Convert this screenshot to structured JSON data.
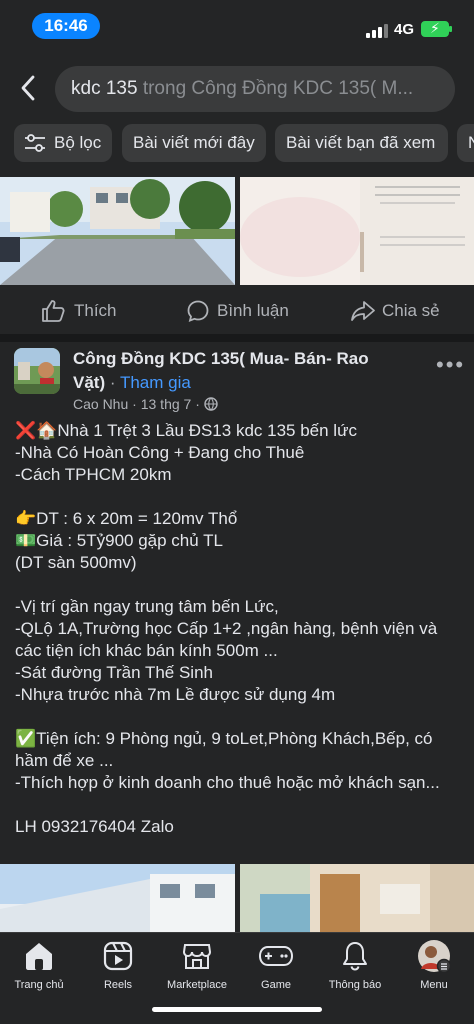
{
  "status": {
    "time": "16:46",
    "network": "4G"
  },
  "search": {
    "query": "kdc 135",
    "scope": " trong Công Đồng KDC 135( M..."
  },
  "chips": [
    {
      "label": "Bộ lọc"
    },
    {
      "label": "Bài viết mới đây"
    },
    {
      "label": "Bài viết bạn đã xem"
    },
    {
      "label": "N"
    }
  ],
  "actions": {
    "like": "Thích",
    "comment": "Bình luận",
    "share": "Chia sẻ"
  },
  "post": {
    "group_name": "Công Đồng KDC 135( Mua- Bán- Rao Vặt)",
    "separator": " · ",
    "join": "Tham gia",
    "author": "Cao Nhu",
    "date": "13 thg 7",
    "lines": [
      "❌🏠Nhà 1 Trệt 3 Lầu ĐS13 kdc 135 bến lức",
      "-Nhà Có Hoàn Công + Đang cho Thuê",
      "-Cách TPHCM 20km",
      "",
      "👉DT : 6 x 20m = 120mv Thổ",
      "💵Giá : 5Tỷ900 gặp chủ TL",
      "(DT sàn 500mv)",
      "",
      "-Vị trí gần ngay trung tâm bến Lức,",
      "-QLộ 1A,Trường học Cấp 1+2 ,ngân hàng, bệnh viện và các tiện ích khác bán kính 500m ...",
      "-Sát đường Trần Thế Sinh",
      "-Nhựa trước nhà 7m Lề được sử dụng 4m",
      "",
      "✅Tiện ích: 9 Phòng ngủ, 9 toLet,Phòng Khách,Bếp, có hầm để xe ...",
      "-Thích hợp ở kinh doanh cho thuê hoặc mở khách sạn...",
      "",
      "LH 0932176404 Zalo"
    ]
  },
  "nav": [
    {
      "label": "Trang chủ",
      "icon": "home-icon"
    },
    {
      "label": "Reels",
      "icon": "reels-icon"
    },
    {
      "label": "Marketplace",
      "icon": "marketplace-icon"
    },
    {
      "label": "Game",
      "icon": "game-icon"
    },
    {
      "label": "Thông báo",
      "icon": "bell-icon"
    },
    {
      "label": "Menu",
      "icon": "menu-avatar-icon"
    }
  ],
  "colors": {
    "accent": "#4599ff",
    "background": "#242526",
    "time_pill": "#0a84ff"
  }
}
